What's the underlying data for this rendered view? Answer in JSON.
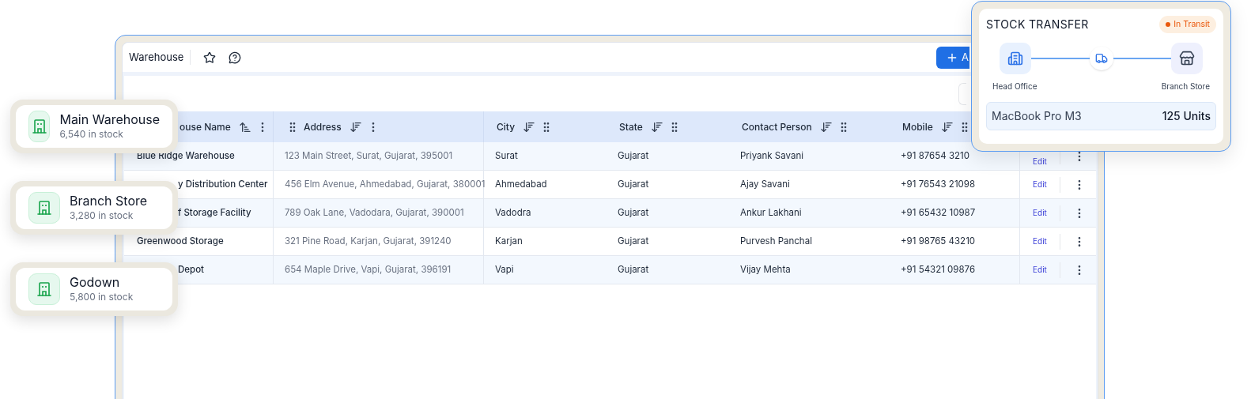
{
  "window": {
    "title": "Warehouse",
    "add_button": "A"
  },
  "table": {
    "columns": [
      {
        "label": "ouse Name",
        "kind": "name"
      },
      {
        "label": "Address",
        "kind": "address"
      },
      {
        "label": "City",
        "kind": "plain"
      },
      {
        "label": "State",
        "kind": "plain"
      },
      {
        "label": "Contact Person",
        "kind": "plain"
      },
      {
        "label": "Mobile",
        "kind": "plain"
      }
    ],
    "rows": [
      {
        "kind": "full",
        "cells": [
          "Blue Ridge Warehouse",
          "123 Main Street, Surat, Gujarat, 395001",
          "Surat",
          "Gujarat",
          "Priyank Savani",
          "+91 87654 3210"
        ],
        "action": "Edit"
      },
      {
        "kind": "clipped",
        "cells": [
          "y Distribution Center",
          "456 Elm Avenue, Ahmedabad, Gujarat, 380001",
          "Ahmedabad",
          "Gujarat",
          "Ajay Savani",
          "+91 76543 21098"
        ],
        "action": "Edit"
      },
      {
        "kind": "clipped",
        "cells": [
          "f Storage Facility",
          "789 Oak Lane, Vadodara, Gujarat, 390001",
          "Vadodra",
          "Gujarat",
          "Ankur Lakhani",
          "+91 65432 10987"
        ],
        "action": "Edit"
      },
      {
        "kind": "full",
        "cells": [
          "Greenwood Storage",
          "321 Pine Road, Karjan, Gujarat, 391240",
          "Karjan",
          "Gujarat",
          "Purvesh Panchal",
          "+91 98765 43210"
        ],
        "action": "Edit"
      },
      {
        "kind": "clipped",
        "cells": [
          "Depot",
          "654 Maple Drive, Vapi, Gujarat, 396191",
          "Vapi",
          "Gujarat",
          "Vijay Mehta",
          "+91 54321 09876"
        ],
        "action": "Edit"
      }
    ]
  },
  "locations": [
    {
      "name": "Main Warehouse",
      "stock": "6,540 in stock"
    },
    {
      "name": "Branch Store",
      "stock": "3,280 in stock"
    },
    {
      "name": "Godown",
      "stock": "5,800 in stock"
    }
  ],
  "transfer": {
    "title": "STOCK TRANSFER",
    "status": {
      "label": "In Transit",
      "color": "#ea580c"
    },
    "from": "Head Office",
    "to": "Branch Store",
    "item": "MacBook Pro M3",
    "quantity": "125 Units"
  }
}
